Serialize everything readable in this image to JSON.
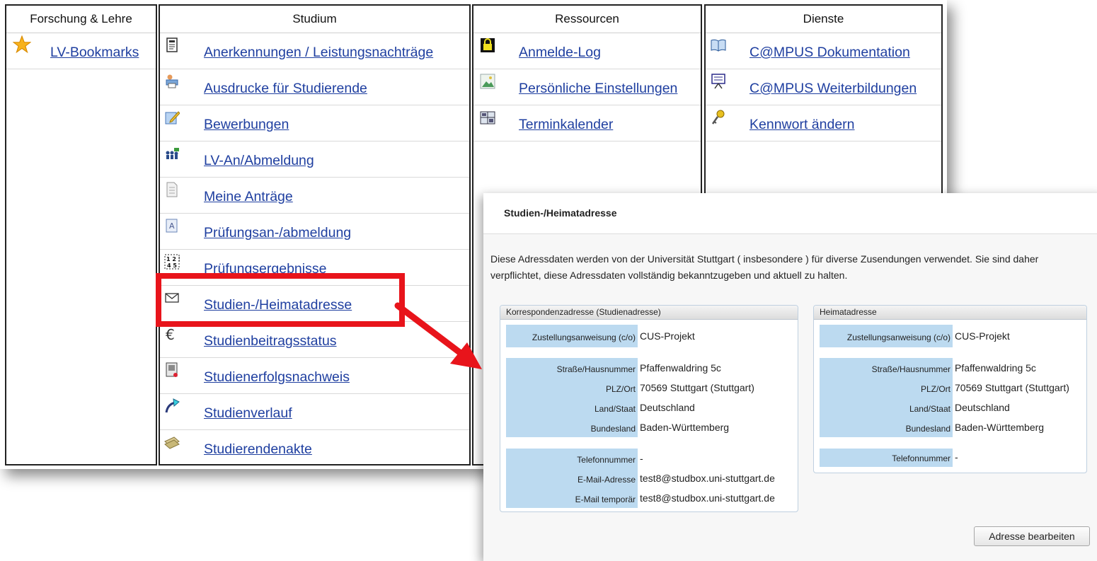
{
  "menu": {
    "columns": [
      {
        "header": "Forschung & Lehre",
        "items": [
          {
            "label": "LV-Bookmarks",
            "icon": "star-icon"
          }
        ]
      },
      {
        "header": "Studium",
        "items": [
          {
            "label": "Anerkennungen / Leistungsnachträge",
            "icon": "document-icon"
          },
          {
            "label": "Ausdrucke für Studierende",
            "icon": "printer-person-icon"
          },
          {
            "label": "Bewerbungen",
            "icon": "pencil-form-icon"
          },
          {
            "label": "LV-An/Abmeldung",
            "icon": "people-group-icon"
          },
          {
            "label": "Meine Anträge",
            "icon": "page-icon"
          },
          {
            "label": "Prüfungsan-/abmeldung",
            "icon": "exam-sheet-icon"
          },
          {
            "label": "Prüfungsergebnisse",
            "icon": "grades-icon"
          },
          {
            "label": "Studien-/Heimatadresse",
            "icon": "envelope-icon"
          },
          {
            "label": "Studienbeitragsstatus",
            "icon": "euro-icon"
          },
          {
            "label": "Studienerfolgsnachweis",
            "icon": "certificate-icon"
          },
          {
            "label": "Studienverlauf",
            "icon": "curve-arrow-icon"
          },
          {
            "label": "Studierendenakte",
            "icon": "folder-stack-icon"
          }
        ]
      },
      {
        "header": "Ressourcen",
        "items": [
          {
            "label": "Anmelde-Log",
            "icon": "lock-icon"
          },
          {
            "label": "Persönliche Einstellungen",
            "icon": "image-icon"
          },
          {
            "label": "Terminkalender",
            "icon": "calendar-icon"
          }
        ]
      },
      {
        "header": "Dienste",
        "items": [
          {
            "label": "C@MPUS Dokumentation",
            "icon": "book-icon"
          },
          {
            "label": "C@MPUS Weiterbildungen",
            "icon": "presentation-board-icon"
          },
          {
            "label": "Kennwort ändern",
            "icon": "key-icon"
          }
        ]
      }
    ]
  },
  "dialog": {
    "title": "Studien-/Heimatadresse",
    "intro": "Diese Adressdaten werden von der Universität Stuttgart ( insbesondere ) für diverse Zusendungen verwendet. Sie sind daher verpflichtet, diese Adressdaten vollständig bekanntzugeben und aktuell zu halten.",
    "edit_button": "Adresse bearbeiten",
    "correspondence": {
      "title": "Korrespondenzadresse (Studienadresse)",
      "care_of_label": "Zustellungsanweisung (c/o)",
      "care_of": "CUS-Projekt",
      "street_label": "Straße/Hausnummer",
      "street": "Pfaffenwaldring 5c",
      "city_label": "PLZ/Ort",
      "city": "70569 Stuttgart (Stuttgart)",
      "country_label": "Land/Staat",
      "country": "Deutschland",
      "state_label": "Bundesland",
      "state": "Baden-Württemberg",
      "phone_label": "Telefonnummer",
      "phone": "-",
      "email_label": "E-Mail-Adresse",
      "email": "test8@studbox.uni-stuttgart.de",
      "email_temp_label": "E-Mail temporär",
      "email_temp": "test8@studbox.uni-stuttgart.de"
    },
    "home": {
      "title": "Heimatadresse",
      "care_of_label": "Zustellungsanweisung (c/o)",
      "care_of": "CUS-Projekt",
      "street_label": "Straße/Hausnummer",
      "street": "Pfaffenwaldring 5c",
      "city_label": "PLZ/Ort",
      "city": "70569 Stuttgart (Stuttgart)",
      "country_label": "Land/Staat",
      "country": "Deutschland",
      "state_label": "Bundesland",
      "state": "Baden-Württemberg",
      "phone_label": "Telefonnummer",
      "phone": "-"
    }
  },
  "annotation": {
    "highlight_color": "#e8141b"
  }
}
